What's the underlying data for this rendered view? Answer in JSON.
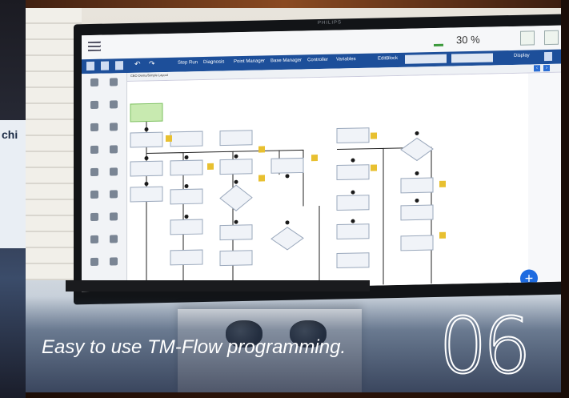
{
  "caption": "Easy to use TM-Flow programming.",
  "slide_number": "06",
  "monitor": {
    "brand": "PHILIPS"
  },
  "ui": {
    "percent": "30 %",
    "toolbar": {
      "items": [
        "Step Run",
        "Diagnosis",
        "Point Manager",
        "Base Manager",
        "Controller",
        "Variables",
        "EditBlock"
      ],
      "display_label": "Display"
    },
    "tab": "CEO Demo/Simple Layout",
    "colors": {
      "toolbar": "#1d4f9a",
      "start_node": "#c8eab0",
      "add_button": "#1d6be0",
      "caption": "#ffffff"
    }
  }
}
